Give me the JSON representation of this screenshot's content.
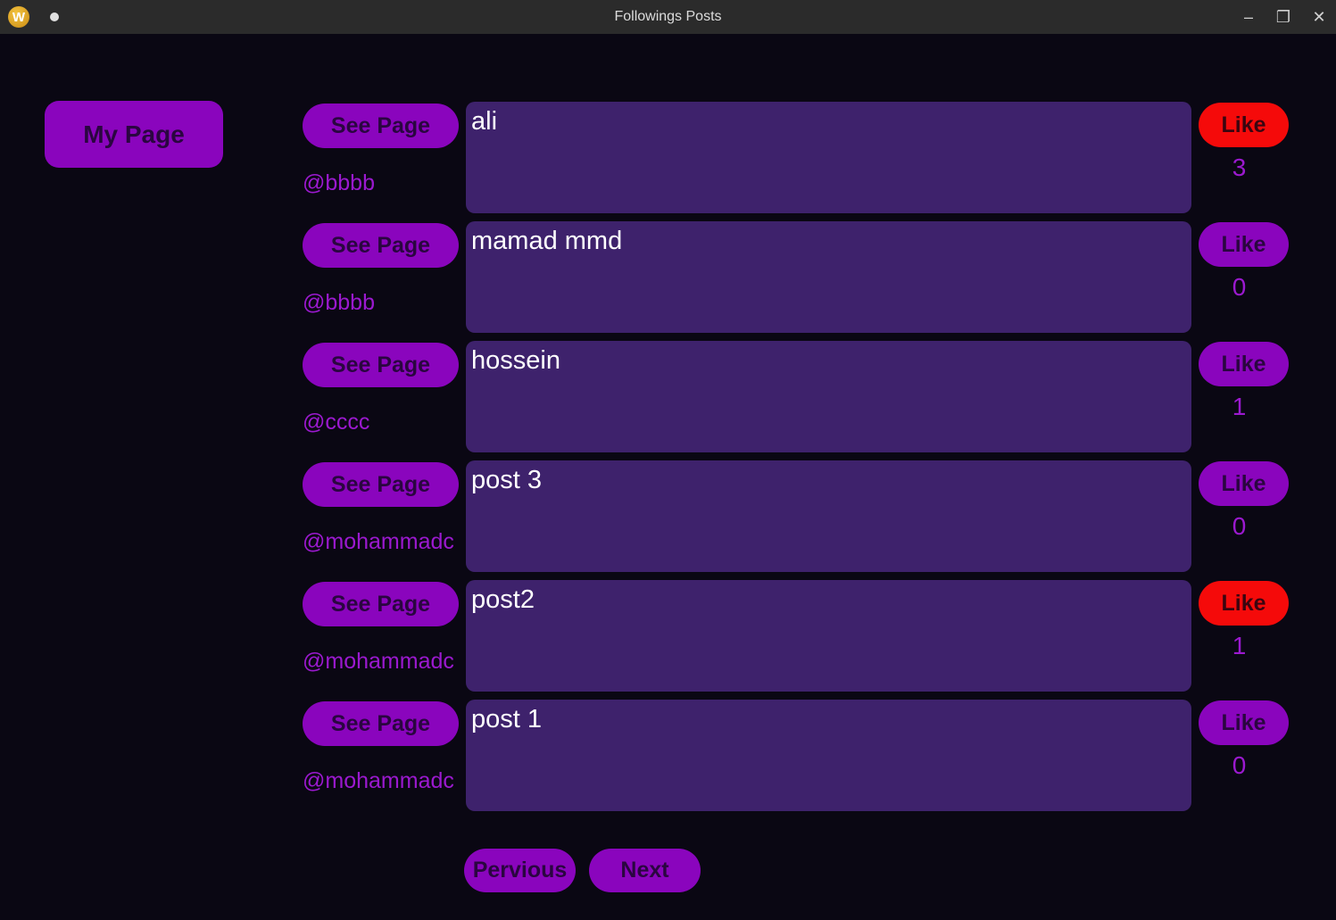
{
  "window": {
    "title": "Followings Posts",
    "app_icon_letter": "W",
    "minimize_icon": "–",
    "maximize_icon": "❐",
    "close_icon": "✕"
  },
  "colors": {
    "background": "#0a0713",
    "button_purple": "#8a05bd",
    "liked_red": "#f50a0a",
    "post_box": "#3e226c",
    "handle_text": "#9b19cf"
  },
  "sidebar": {
    "my_page_label": "My Page"
  },
  "posts": [
    {
      "see_page_label": "See Page",
      "handle": "@bbbb",
      "text": "ali",
      "like_label": "Like",
      "liked": true,
      "likes": "3"
    },
    {
      "see_page_label": "See Page",
      "handle": "@bbbb",
      "text": "mamad mmd",
      "like_label": "Like",
      "liked": false,
      "likes": "0"
    },
    {
      "see_page_label": "See Page",
      "handle": "@cccc",
      "text": "hossein",
      "like_label": "Like",
      "liked": false,
      "likes": "1"
    },
    {
      "see_page_label": "See Page",
      "handle": "@mohammadc",
      "text": "post 3",
      "like_label": "Like",
      "liked": false,
      "likes": "0"
    },
    {
      "see_page_label": "See Page",
      "handle": "@mohammadc",
      "text": "post2",
      "like_label": "Like",
      "liked": true,
      "likes": "1"
    },
    {
      "see_page_label": "See Page",
      "handle": "@mohammadc",
      "text": "post 1",
      "like_label": "Like",
      "liked": false,
      "likes": "0"
    }
  ],
  "pagination": {
    "previous_label": "Pervious",
    "next_label": "Next"
  }
}
